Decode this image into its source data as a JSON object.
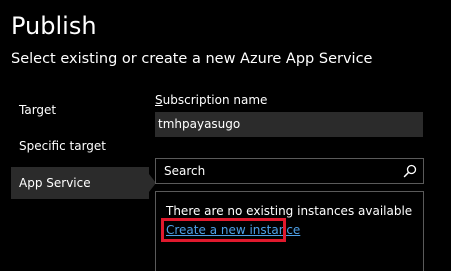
{
  "header": {
    "title": "Publish",
    "subtitle": "Select existing or create a new Azure App Service"
  },
  "sidebar": {
    "items": [
      {
        "label": "Target",
        "selected": false
      },
      {
        "label": "Specific target",
        "selected": false
      },
      {
        "label": "App Service",
        "selected": true
      }
    ]
  },
  "subscription": {
    "label_mnemonic": "S",
    "label_rest": "ubscription name",
    "value": "tmhpayasugo"
  },
  "search": {
    "placeholder": "Search",
    "icon": "search-icon"
  },
  "results": {
    "empty_message": "There are no existing instances available",
    "create_link": "Create a new instance"
  },
  "colors": {
    "background": "#000000",
    "panel": "#2b2b2b",
    "border": "#5a5a5a",
    "link": "#4ea1e8",
    "highlight": "#e0192d"
  }
}
